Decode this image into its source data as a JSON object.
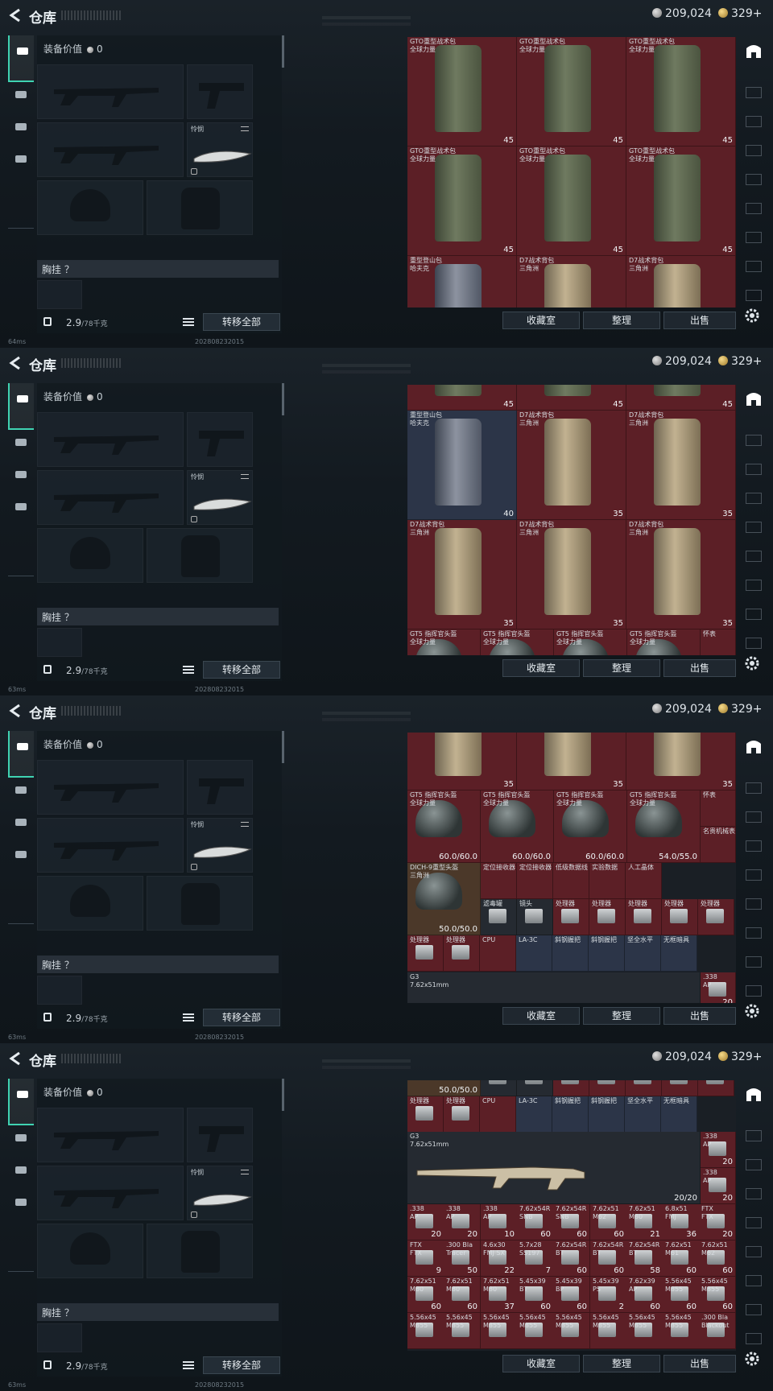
{
  "screens": [
    {
      "title": "仓库",
      "silver": "209,024",
      "gold": "329+"
    },
    {
      "title": "仓库",
      "silver": "209,024",
      "gold": "329+"
    },
    {
      "title": "仓库",
      "silver": "209,024",
      "gold": "329+"
    },
    {
      "title": "仓库",
      "silver": "209,024",
      "gold": "329+"
    }
  ],
  "equip": {
    "value_label": "装备价值",
    "value": "0",
    "knife_label": "怜悯",
    "chest_label": "胸挂 ？",
    "weight": "2.9",
    "weight_unit": "/78千克",
    "transfer_all": "转移全部"
  },
  "buttons": {
    "collection": "收藏室",
    "sort": "整理",
    "sell": "出售"
  },
  "status": {
    "ping1": "64ms",
    "ping": "63ms",
    "build": "202808232015"
  },
  "stash": [
    [
      {
        "name": "GTO重型战术包\n全球力量",
        "count": "45",
        "kind": "pack-green"
      },
      {
        "name": "GTO重型战术包\n全球力量",
        "count": "45",
        "kind": "pack-green"
      },
      {
        "name": "GTO重型战术包\n全球力量",
        "count": "45",
        "kind": "pack-green"
      },
      {
        "name": "GTO重型战术包\n全球力量",
        "count": "45",
        "kind": "pack-green"
      },
      {
        "name": "GTO重型战术包\n全球力量",
        "count": "45",
        "kind": "pack-green"
      },
      {
        "name": "GTO重型战术包\n全球力量",
        "count": "45",
        "kind": "pack-green"
      },
      {
        "name": "重型登山包\n哈夫克",
        "count": "",
        "kind": "pack-gray"
      },
      {
        "name": "D7战术背包\n三角洲",
        "count": "",
        "kind": "pack-tan"
      },
      {
        "name": "D7战术背包\n三角洲",
        "count": "",
        "kind": "pack-tan"
      }
    ],
    [
      {
        "name": "",
        "count": "45",
        "kind": "pack-green"
      },
      {
        "name": "",
        "count": "45",
        "kind": "pack-green"
      },
      {
        "name": "",
        "count": "45",
        "kind": "pack-green"
      },
      {
        "name": "重型登山包\n哈夫克",
        "count": "40",
        "kind": "pack-gray"
      },
      {
        "name": "D7战术背包\n三角洲",
        "count": "35",
        "kind": "pack-tan"
      },
      {
        "name": "D7战术背包\n三角洲",
        "count": "35",
        "kind": "pack-tan"
      },
      {
        "name": "D7战术背包\n三角洲",
        "count": "35",
        "kind": "pack-tan"
      },
      {
        "name": "D7战术背包\n三角洲",
        "count": "35",
        "kind": "pack-tan"
      },
      {
        "name": "D7战术背包\n三角洲",
        "count": "35",
        "kind": "pack-tan"
      }
    ]
  ],
  "row_helmets": [
    "GT5 指挥官头盔\n全球力量",
    "GT5 指挥官头盔\n全球力量",
    "GT5 指挥官头盔\n全球力量",
    "GT5 指挥官头盔\n全球力量"
  ],
  "helmet_dur": [
    "60.0/60.0",
    "60.0/60.0",
    "60.0/60.0",
    "54.0/55.0"
  ],
  "watch_labels": [
    "怀表",
    "名贵机械表"
  ],
  "misc_row": [
    "DICH-9重型头盔\n三角洲",
    "定位接收器",
    "定位接收器",
    "低级数据线",
    "实验数据",
    "人工晶体"
  ],
  "misc_dur": "50.0/50.0",
  "misc_row2": [
    "滤毒罐",
    "镜头",
    "处理器",
    "处理器",
    "处理器",
    "处理器",
    "处理器"
  ],
  "misc_row3": [
    "处理器",
    "处理器",
    "CPU",
    "LA-3C",
    "斜钢握把",
    "斜钢握把",
    "坚全水平",
    "无框暗具"
  ],
  "gun": {
    "name": "G3",
    "caliber": "7.62x51mm",
    "ammo": "20/20"
  },
  "ammo_side": [
    ".338\nAP",
    ".338\nAP"
  ],
  "ammo_side_count": [
    "20",
    "20"
  ],
  "ammo_rows": [
    [
      ".338\nAP",
      ".338\nAP",
      ".338\nAP",
      "7.62x54R\nSNB",
      "7.62x54R\nSNB",
      "7.62x51\nM62",
      "7.62x51\nM80",
      "6.8x51\nFMJ",
      "FTX\nFTX"
    ],
    [
      "20",
      "20",
      "10",
      "60",
      "60",
      "60",
      "21",
      "36",
      "20"
    ],
    [
      "FTX\nFTX",
      ".300 Bla\nTracer",
      "4.6x30\nFMJ SX",
      "5.7x28\nSS197",
      "7.62x54R\nBT",
      "7.62x54R\nBT",
      "7.62x54R\nBT",
      "7.62x51\nM61",
      "7.62x51\nM62"
    ],
    [
      "9",
      "50",
      "22",
      "7",
      "60",
      "60",
      "58",
      "60",
      "60"
    ],
    [
      "7.62x51\nM80",
      "7.62x51\nM80",
      "7.62x51\nM80",
      "5.45x39\nBT",
      "5.45x39\nBP",
      "5.45x39\nPS",
      "7.62x39\nAP",
      "5.56x45\nM855",
      "5.56x45\nM855"
    ],
    [
      "60",
      "60",
      "37",
      "60",
      "60",
      "2",
      "60",
      "60",
      "60"
    ],
    [
      "5.56x45\nM855",
      "5.56x45\nM855",
      "5.56x45\nM855",
      "5.56x45\nM855",
      "5.56x45\nM855",
      "5.56x45\nM855",
      "5.56x45\nM855",
      "5.56x45\nM855",
      ".300 Bla\nBlackout"
    ]
  ]
}
